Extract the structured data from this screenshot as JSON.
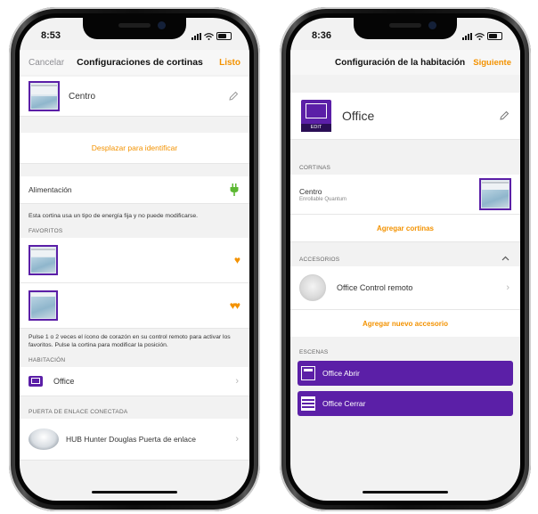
{
  "left": {
    "time": "8:53",
    "nav": {
      "cancel": "Cancelar",
      "title": "Configuraciones de cortinas",
      "done": "Listo"
    },
    "shade_name": "Centro",
    "identify_link": "Desplazar para identificar",
    "power_label": "Alimentación",
    "power_note": "Esta cortina usa un tipo de energía fija y no puede modificarse.",
    "favorites_header": "FAVORITOS",
    "favorites_note": "Pulse 1 o 2 veces el ícono de corazón en su control remoto para activar los favoritos. Pulse la cortina para modificar la posición.",
    "room_header": "HABITACIÓN",
    "room_name": "Office",
    "gateway_header": "PUERTA DE ENLACE CONECTADA",
    "gateway_name": "HUB Hunter Douglas Puerta de enlace"
  },
  "right": {
    "time": "8:36",
    "nav": {
      "title": "Configuración de la habitación",
      "next": "Siguiente"
    },
    "room_name": "Office",
    "edit_badge": "EDIT",
    "shades_header": "CORTINAS",
    "shade_name": "Centro",
    "shade_type": "Enrollable Quantum",
    "add_shades": "Agregar cortinas",
    "accessories_header": "ACCESORIOS",
    "accessory_name": "Office Control remoto",
    "add_accessory": "Agregar nuevo accesorio",
    "scenes_header": "ESCENAS",
    "scenes": [
      "Office Abrir",
      "Office Cerrar"
    ]
  },
  "colors": {
    "accent": "#f39200",
    "brand_purple": "#5b1fa7"
  },
  "icons": [
    "pencil-icon",
    "plug-icon",
    "heart-icon",
    "chevron-right-icon",
    "tv-icon",
    "chevron-up-icon"
  ]
}
